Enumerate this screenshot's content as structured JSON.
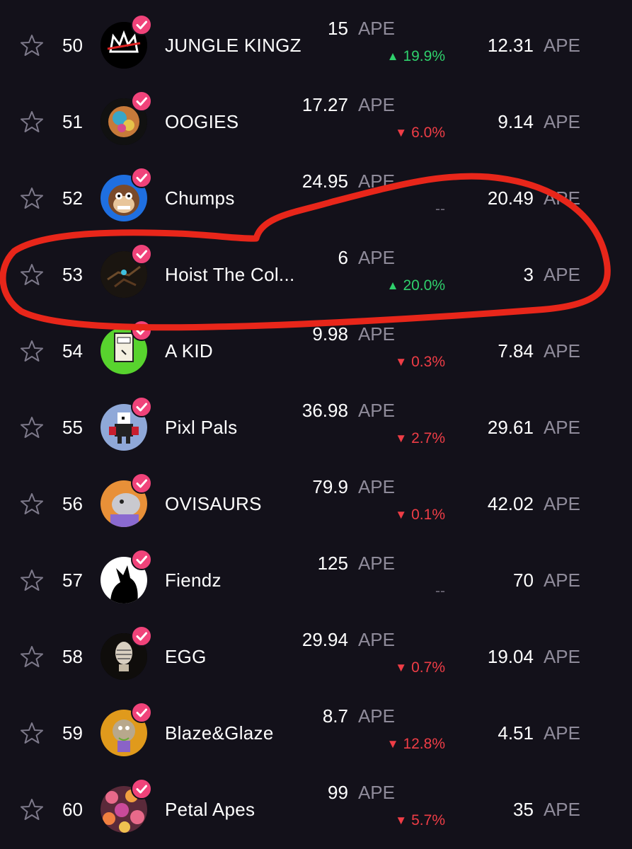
{
  "currency": "APE",
  "colors": {
    "up": "#2fd06c",
    "down": "#ef3d46",
    "verified": "#f0437a",
    "annotation": "#e8261a"
  },
  "rows": [
    {
      "rank": "50",
      "name": "JUNGLE KINGZ",
      "price": "15",
      "change": "19.9%",
      "dir": "up",
      "volume": "12.31",
      "avatar": "crown-logo-avatar"
    },
    {
      "rank": "51",
      "name": "OOGIES",
      "price": "17.27",
      "change": "6.0%",
      "dir": "down",
      "volume": "9.14",
      "avatar": "colorful-planet-avatar"
    },
    {
      "rank": "52",
      "name": "Chumps",
      "price": "24.95",
      "change": "--",
      "dir": "flat",
      "volume": "20.49",
      "avatar": "monkey-face-avatar"
    },
    {
      "rank": "53",
      "name": "Hoist The Col...",
      "price": "6",
      "change": "20.0%",
      "dir": "up",
      "volume": "3",
      "avatar": "dark-gem-avatar"
    },
    {
      "rank": "54",
      "name": "A KID",
      "price": "9.98",
      "change": "0.3%",
      "dir": "down",
      "volume": "7.84",
      "avatar": "green-robot-avatar"
    },
    {
      "rank": "55",
      "name": "Pixl Pals",
      "price": "36.98",
      "change": "2.7%",
      "dir": "down",
      "volume": "29.61",
      "avatar": "pixel-character-avatar"
    },
    {
      "rank": "56",
      "name": "OVISAURS",
      "price": "79.9",
      "change": "0.1%",
      "dir": "down",
      "volume": "42.02",
      "avatar": "dino-avatar"
    },
    {
      "rank": "57",
      "name": "Fiendz",
      "price": "125",
      "change": "--",
      "dir": "flat",
      "volume": "70",
      "avatar": "silhouette-avatar"
    },
    {
      "rank": "58",
      "name": "EGG",
      "price": "29.94",
      "change": "0.7%",
      "dir": "down",
      "volume": "19.04",
      "avatar": "egg-avatar"
    },
    {
      "rank": "59",
      "name": "Blaze&Glaze",
      "price": "8.7",
      "change": "12.8%",
      "dir": "down",
      "volume": "4.51",
      "avatar": "donut-character-avatar"
    },
    {
      "rank": "60",
      "name": "Petal Apes",
      "price": "99",
      "change": "5.7%",
      "dir": "down",
      "volume": "35",
      "avatar": "petal-pattern-avatar"
    }
  ]
}
